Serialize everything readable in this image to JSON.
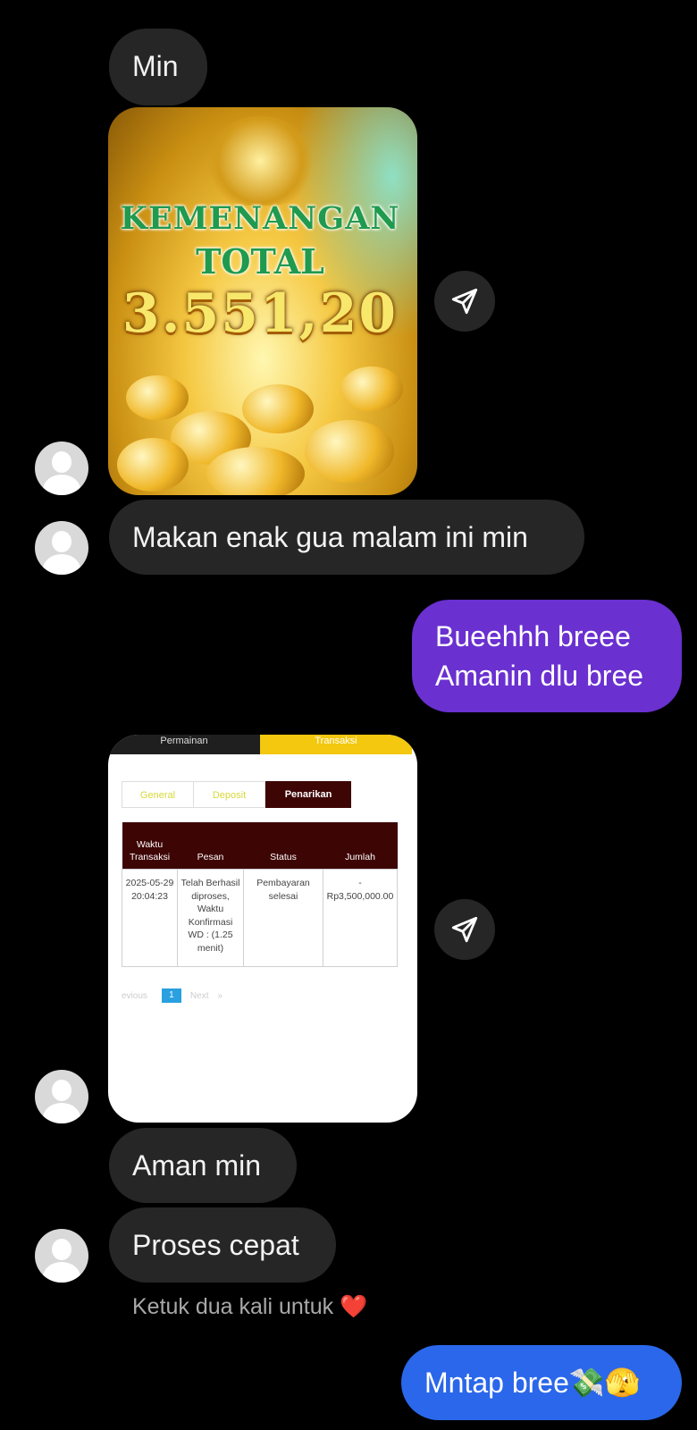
{
  "messages": {
    "m1": "Min",
    "m2": "Makan enak gua malam ini min",
    "m3_line1": "Bueehhh breee",
    "m3_line2": "Amanin dlu bree",
    "m4": "Aman min",
    "m5": "Proses cepat",
    "m6": "Mntap bree💸🫣"
  },
  "like_hint": "Ketuk dua kali untuk",
  "like_hint_icon": "❤️",
  "win_image": {
    "line1": "KEMENANGAN",
    "line2": "TOTAL",
    "amount": "3.551,20"
  },
  "tx_image": {
    "tabs": [
      "Permainan",
      "Transaksi"
    ],
    "segments": [
      "General",
      "Deposit",
      "Penarikan"
    ],
    "headers": [
      "Waktu Transaksi",
      "Pesan",
      "Status",
      "Jumlah"
    ],
    "row": {
      "time": "2025-05-29 20:04:23",
      "message": "Telah Berhasil diproses, Waktu Konfirmasi WD : (1.25 menit)",
      "status": "Pembayaran selesai",
      "amount": "- Rp3,500,000.00"
    },
    "pager": {
      "prev": "evious",
      "current": "1",
      "next": "Next",
      "last": "»"
    }
  },
  "colors": {
    "background": "#000000",
    "incoming_bubble": "#262626",
    "outgoing_purple": "#6a30d0",
    "outgoing_blue": "#2a67ea"
  }
}
